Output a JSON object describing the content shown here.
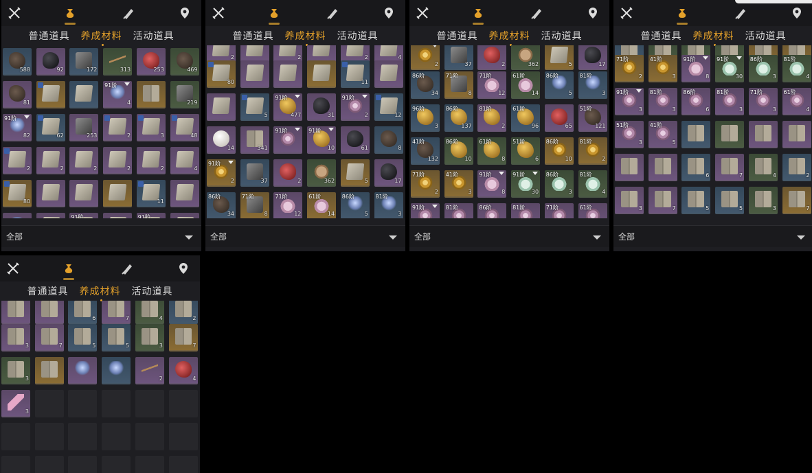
{
  "icons": [
    "weapon-icon",
    "material-pouch-icon",
    "scroll-icon",
    "map-pin-icon"
  ],
  "tabs": [
    "普通道具",
    "养成材料",
    "活动道具"
  ],
  "active_tab": 1,
  "filter_label": "全部",
  "accent": "#e3a02a",
  "panels": [
    {
      "rows": [
        [
          {
            "c": "blue",
            "a": "ore",
            "n": "588"
          },
          {
            "c": "purple",
            "a": "black",
            "n": "92"
          },
          {
            "c": "blue",
            "a": "cube",
            "n": "172"
          },
          {
            "c": "green",
            "a": "twig",
            "n": "313"
          },
          {
            "c": "purple",
            "a": "red",
            "n": "253"
          },
          {
            "c": "green",
            "a": "ore",
            "n": "469"
          }
        ],
        [
          {
            "c": "purple",
            "a": "ore",
            "n": "81"
          },
          {
            "c": "gold",
            "a": "scroll",
            "b": 1
          },
          {
            "c": "blue",
            "a": "scroll"
          },
          {
            "c": "purple",
            "a": "spirit",
            "l": "91阶",
            "n": "4",
            "m": 1
          },
          {
            "c": "gold",
            "a": "book"
          },
          {
            "c": "green",
            "a": "cube",
            "n": "219"
          }
        ],
        [
          {
            "c": "purple",
            "a": "spirit",
            "l": "91阶",
            "n": "82",
            "m": 1
          },
          {
            "c": "blue",
            "a": "scroll",
            "n": "62",
            "b": 1
          },
          {
            "c": "purple",
            "a": "cube",
            "n": "253"
          },
          {
            "c": "purple",
            "a": "scroll",
            "n": "2",
            "b": 1
          },
          {
            "c": "purple",
            "a": "scroll",
            "n": "3",
            "b": 1
          },
          {
            "c": "purple",
            "a": "scroll",
            "n": "48",
            "b": 1
          }
        ],
        [
          {
            "c": "purple",
            "a": "scroll",
            "n": "2",
            "b": 1
          },
          {
            "c": "purple",
            "a": "scroll",
            "n": "2"
          },
          {
            "c": "purple",
            "a": "scroll",
            "n": "2"
          },
          {
            "c": "purple",
            "a": "scroll",
            "n": "2"
          },
          {
            "c": "purple",
            "a": "scroll",
            "n": "2"
          },
          {
            "c": "purple",
            "a": "scroll",
            "n": "4"
          }
        ],
        [
          {
            "c": "gold",
            "a": "scroll",
            "n": "80",
            "b": 1
          },
          {
            "c": "purple",
            "a": "scroll"
          },
          {
            "c": "purple",
            "a": "scroll"
          },
          {
            "c": "gold",
            "a": "scroll"
          },
          {
            "c": "blue",
            "a": "scroll",
            "n": "11",
            "b": 1
          },
          {
            "c": "purple",
            "a": "scroll"
          }
        ],
        [
          {
            "c": "purple",
            "a": "spirit"
          },
          {
            "c": "purple",
            "a": "scroll"
          },
          {
            "c": "purple",
            "a": "scroll",
            "l": "91阶"
          },
          {
            "c": "purple",
            "a": "scroll"
          },
          {
            "c": "purple",
            "a": "scroll",
            "l": "91阶"
          },
          {
            "c": "purple",
            "a": "scroll"
          }
        ]
      ]
    },
    {
      "rows": [
        [
          {
            "c": "purple",
            "a": "scroll",
            "n": "2"
          },
          {
            "c": "purple",
            "a": "scroll"
          },
          {
            "c": "purple",
            "a": "scroll",
            "n": "2"
          },
          {
            "c": "purple",
            "a": "scroll"
          },
          {
            "c": "purple",
            "a": "scroll",
            "n": "2"
          },
          {
            "c": "purple",
            "a": "scroll",
            "n": "4"
          }
        ],
        [
          {
            "c": "gold",
            "a": "scroll",
            "n": "80",
            "b": 1
          },
          {
            "c": "purple",
            "a": "scroll"
          },
          {
            "c": "purple",
            "a": "scroll"
          },
          {
            "c": "gold",
            "a": "scroll"
          },
          {
            "c": "blue",
            "a": "scroll",
            "n": "11",
            "b": 1
          },
          {
            "c": "purple",
            "a": "scroll"
          }
        ],
        [
          {
            "c": "purple",
            "a": "scroll"
          },
          {
            "c": "blue",
            "a": "scroll",
            "n": "5",
            "b": 1
          },
          {
            "c": "purple",
            "a": "nugget",
            "l": "91阶",
            "n": "477",
            "m": 1
          },
          {
            "c": "purple",
            "a": "black",
            "n": "31"
          },
          {
            "c": "purple",
            "a": "pshell",
            "l": "91阶",
            "n": "2",
            "m": 1
          },
          {
            "c": "blue",
            "a": "scroll",
            "n": "12",
            "b": 1
          }
        ],
        [
          {
            "c": "purple",
            "a": "pearl",
            "n": "14"
          },
          {
            "c": "purple",
            "a": "book",
            "n": "341"
          },
          {
            "c": "purple",
            "a": "pshell",
            "l": "91阶",
            "m": 1
          },
          {
            "c": "purple",
            "a": "nugget",
            "l": "91阶",
            "n": "10",
            "m": 1
          },
          {
            "c": "purple",
            "a": "black",
            "n": "61"
          },
          {
            "c": "blue",
            "a": "ore",
            "n": "8"
          }
        ],
        [
          {
            "c": "gold",
            "a": "shell",
            "l": "91阶",
            "n": "2",
            "m": 1
          },
          {
            "c": "blue",
            "a": "cube",
            "n": "37"
          },
          {
            "c": "purple",
            "a": "red",
            "n": "2"
          },
          {
            "c": "green",
            "a": "coin",
            "n": "362"
          },
          {
            "c": "gold",
            "a": "scroll",
            "n": "5"
          },
          {
            "c": "purple",
            "a": "black",
            "n": "17"
          }
        ],
        [
          {
            "c": "blue",
            "a": "ore",
            "l": "86阶",
            "n": "34"
          },
          {
            "c": "gold",
            "a": "cube",
            "l": "71阶",
            "n": "8"
          },
          {
            "c": "purple",
            "a": "flower",
            "l": "71阶",
            "n": "12"
          },
          {
            "c": "gold",
            "a": "flower",
            "l": "61阶",
            "n": "14"
          },
          {
            "c": "blue",
            "a": "spirit",
            "l": "86阶",
            "n": "5"
          },
          {
            "c": "blue",
            "a": "spirit",
            "l": "81阶",
            "n": "3"
          }
        ]
      ]
    },
    {
      "rows": [
        [
          {
            "c": "gold",
            "a": "shell",
            "n": "2",
            "m": 1
          },
          {
            "c": "blue",
            "a": "cube",
            "n": "37"
          },
          {
            "c": "purple",
            "a": "red",
            "n": "2"
          },
          {
            "c": "green",
            "a": "coin",
            "n": "362"
          },
          {
            "c": "gold",
            "a": "scroll",
            "n": "5"
          },
          {
            "c": "purple",
            "a": "black",
            "n": "17"
          }
        ],
        [
          {
            "c": "blue",
            "a": "ore",
            "l": "86阶",
            "n": "34"
          },
          {
            "c": "gold",
            "a": "cube",
            "l": "71阶",
            "n": "8"
          },
          {
            "c": "purple",
            "a": "flower",
            "l": "71阶",
            "n": "12"
          },
          {
            "c": "green",
            "a": "flower",
            "l": "61阶",
            "n": "14"
          },
          {
            "c": "blue",
            "a": "spirit",
            "l": "86阶",
            "n": "5"
          },
          {
            "c": "blue",
            "a": "spirit",
            "l": "81阶",
            "n": "3"
          }
        ],
        [
          {
            "c": "blue",
            "a": "nugget",
            "l": "96阶",
            "n": "3"
          },
          {
            "c": "blue",
            "a": "nugget",
            "l": "86阶",
            "n": "137"
          },
          {
            "c": "purple",
            "a": "nugget",
            "l": "81阶",
            "n": "2"
          },
          {
            "c": "blue",
            "a": "nugget",
            "l": "61阶",
            "n": "96"
          },
          {
            "c": "purple",
            "a": "red",
            "n": "65"
          },
          {
            "c": "purple",
            "a": "ore",
            "l": "51阶",
            "n": "121"
          }
        ],
        [
          {
            "c": "blue",
            "a": "ore",
            "l": "41阶",
            "n": "132"
          },
          {
            "c": "green",
            "a": "nugget",
            "l": "86阶",
            "n": "10"
          },
          {
            "c": "green",
            "a": "nugget",
            "l": "61阶",
            "n": "8"
          },
          {
            "c": "green",
            "a": "nugget",
            "l": "51阶",
            "n": "6"
          },
          {
            "c": "gold",
            "a": "shell",
            "l": "86阶",
            "n": "10"
          },
          {
            "c": "gold",
            "a": "shell",
            "l": "81阶",
            "n": "2"
          }
        ],
        [
          {
            "c": "gold",
            "a": "shell",
            "l": "71阶",
            "n": "2"
          },
          {
            "c": "gold",
            "a": "shell",
            "l": "41阶",
            "n": "3"
          },
          {
            "c": "purple",
            "a": "flower",
            "l": "91阶",
            "n": "8",
            "m": 1
          },
          {
            "c": "green",
            "a": "lotus",
            "l": "91阶",
            "n": "30",
            "m": 1
          },
          {
            "c": "green",
            "a": "lotus",
            "l": "86阶",
            "n": "3"
          },
          {
            "c": "green",
            "a": "lotus",
            "l": "81阶",
            "n": "4"
          }
        ],
        [
          {
            "c": "purple",
            "a": "pshell",
            "l": "91阶",
            "m": 1
          },
          {
            "c": "purple",
            "a": "pshell",
            "l": "81阶"
          },
          {
            "c": "purple",
            "a": "pshell",
            "l": "86阶"
          },
          {
            "c": "purple",
            "a": "pshell",
            "l": "81阶"
          },
          {
            "c": "purple",
            "a": "pshell",
            "l": "71阶"
          },
          {
            "c": "purple",
            "a": "pshell",
            "l": "61阶"
          }
        ]
      ]
    },
    {
      "rows": [
        [
          {
            "c": "blue",
            "a": "book",
            "n": "132"
          },
          {
            "c": "green",
            "a": "book",
            "n": "10"
          },
          {
            "c": "green",
            "a": "book",
            "n": "6"
          },
          {
            "c": "green",
            "a": "book",
            "n": "8"
          },
          {
            "c": "gold",
            "a": "book",
            "n": "10"
          },
          {
            "c": "gold",
            "a": "book",
            "n": "2"
          }
        ],
        [
          {
            "c": "gold",
            "a": "shell",
            "l": "71阶",
            "n": "2"
          },
          {
            "c": "gold",
            "a": "shell",
            "l": "41阶",
            "n": "3"
          },
          {
            "c": "purple",
            "a": "flower",
            "l": "91阶",
            "n": "8",
            "m": 1
          },
          {
            "c": "green",
            "a": "lotus",
            "l": "91阶",
            "n": "30",
            "m": 1
          },
          {
            "c": "green",
            "a": "lotus",
            "l": "86阶",
            "n": "3"
          },
          {
            "c": "green",
            "a": "lotus",
            "l": "81阶",
            "n": "4"
          }
        ],
        [
          {
            "c": "purple",
            "a": "pshell",
            "l": "91阶",
            "n": "3",
            "m": 1
          },
          {
            "c": "purple",
            "a": "pshell",
            "l": "81阶",
            "n": "3"
          },
          {
            "c": "purple",
            "a": "pshell",
            "l": "86阶",
            "n": "6"
          },
          {
            "c": "purple",
            "a": "pshell",
            "l": "81阶",
            "n": "3"
          },
          {
            "c": "purple",
            "a": "pshell",
            "l": "71阶",
            "n": "3"
          },
          {
            "c": "purple",
            "a": "pshell",
            "l": "61阶",
            "n": "4"
          }
        ],
        [
          {
            "c": "purple",
            "a": "pshell",
            "l": "51阶",
            "n": "3"
          },
          {
            "c": "purple",
            "a": "pshell",
            "l": "41阶",
            "n": "5"
          },
          {
            "c": "blue",
            "a": "book"
          },
          {
            "c": "green",
            "a": "book"
          },
          {
            "c": "purple",
            "a": "book"
          },
          {
            "c": "purple",
            "a": "book"
          }
        ],
        [
          {
            "c": "purple",
            "a": "book"
          },
          {
            "c": "purple",
            "a": "book"
          },
          {
            "c": "blue",
            "a": "book",
            "n": "6"
          },
          {
            "c": "purple",
            "a": "book",
            "n": "7"
          },
          {
            "c": "green",
            "a": "book",
            "n": "4"
          },
          {
            "c": "blue",
            "a": "book",
            "n": "2"
          }
        ],
        [
          {
            "c": "purple",
            "a": "book",
            "n": "3"
          },
          {
            "c": "purple",
            "a": "book",
            "n": "7"
          },
          {
            "c": "blue",
            "a": "book",
            "n": "5"
          },
          {
            "c": "blue",
            "a": "book",
            "n": "5"
          },
          {
            "c": "green",
            "a": "book",
            "n": "3"
          },
          {
            "c": "gold",
            "a": "book",
            "n": "7"
          }
        ]
      ]
    }
  ],
  "bottom_panel": {
    "rows": [
      [
        {
          "c": "purple",
          "a": "book"
        },
        {
          "c": "purple",
          "a": "book"
        },
        {
          "c": "blue",
          "a": "book",
          "n": "6"
        },
        {
          "c": "purple",
          "a": "book",
          "n": "7"
        },
        {
          "c": "green",
          "a": "book",
          "n": "4"
        },
        {
          "c": "blue",
          "a": "book",
          "n": "2"
        }
      ],
      [
        {
          "c": "purple",
          "a": "book",
          "n": "3"
        },
        {
          "c": "purple",
          "a": "book",
          "n": "7"
        },
        {
          "c": "blue",
          "a": "book",
          "n": "5"
        },
        {
          "c": "blue",
          "a": "book",
          "n": "5"
        },
        {
          "c": "green",
          "a": "book",
          "n": "3"
        },
        {
          "c": "gold",
          "a": "book",
          "n": "7"
        }
      ],
      [
        {
          "c": "green",
          "a": "book",
          "n": "3"
        },
        {
          "c": "gold",
          "a": "book"
        },
        {
          "c": "purple",
          "a": "spirit"
        },
        {
          "c": "blue",
          "a": "spirit"
        },
        {
          "c": "purple",
          "a": "twig",
          "n": "2"
        },
        {
          "c": "purple",
          "a": "red",
          "n": "4"
        }
      ],
      [
        {
          "c": "purple",
          "a": "feather",
          "n": "3"
        },
        {
          "e": 1
        },
        {
          "e": 1
        },
        {
          "e": 1
        },
        {
          "e": 1
        },
        {
          "e": 1
        }
      ],
      [
        {
          "e": 1
        },
        {
          "e": 1
        },
        {
          "e": 1
        },
        {
          "e": 1
        },
        {
          "e": 1
        },
        {
          "e": 1
        }
      ],
      [
        {
          "e": 1
        },
        {
          "e": 1
        },
        {
          "e": 1
        },
        {
          "e": 1
        },
        {
          "e": 1
        },
        {
          "e": 1
        }
      ]
    ]
  }
}
